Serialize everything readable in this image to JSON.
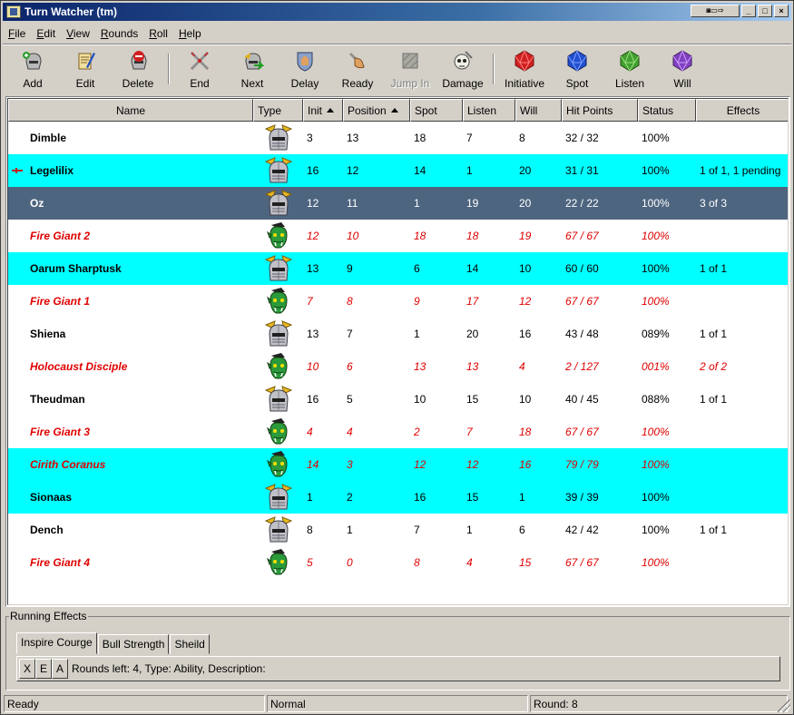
{
  "window": {
    "title": "Turn Watcher (tm)",
    "controls": [
      "minimize",
      "maximize",
      "close"
    ]
  },
  "menu": [
    {
      "label": "File",
      "key": "F",
      "rest": "ile"
    },
    {
      "label": "Edit",
      "key": "E",
      "rest": "dit"
    },
    {
      "label": "View",
      "key": "V",
      "rest": "iew"
    },
    {
      "label": "Rounds",
      "key": "R",
      "rest": "ounds"
    },
    {
      "label": "Roll",
      "key": "R",
      "rest": "oll"
    },
    {
      "label": "Help",
      "key": "H",
      "rest": "elp"
    }
  ],
  "toolbar": {
    "add": "Add",
    "edit": "Edit",
    "delete": "Delete",
    "end": "End",
    "next": "Next",
    "delay": "Delay",
    "ready": "Ready",
    "jump_in": "Jump In",
    "damage": "Damage",
    "initiative": "Initiative",
    "spot": "Spot",
    "listen": "Listen",
    "will": "Will"
  },
  "colors": {
    "ally_row": "#00ffff",
    "selected_row": "#4e6580",
    "enemy_text": "#e00000",
    "die_initiative": "#d02020",
    "die_spot": "#2050d0",
    "die_listen": "#40a030",
    "die_will": "#8040c0"
  },
  "grid": {
    "columns": [
      "Name",
      "Type",
      "Init",
      "Position",
      "Spot",
      "Listen",
      "Will",
      "Hit Points",
      "Status",
      "Effects"
    ],
    "sorted_columns": [
      "Init",
      "Position"
    ],
    "rows": [
      {
        "name": "Dimble",
        "type": "knight-helmet-icon",
        "init": "3",
        "position": "13",
        "spot": "18",
        "listen": "7",
        "will": "8",
        "hp": "32 / 32",
        "status": "100%",
        "effects": "",
        "style": "normal",
        "enemy": false,
        "current": false
      },
      {
        "name": "Legelilix",
        "type": "knight-helmet-icon",
        "init": "16",
        "position": "12",
        "spot": "14",
        "listen": "1",
        "will": "20",
        "hp": "31 / 31",
        "status": "100%",
        "effects": "1 of 1, 1 pending",
        "style": "cyan",
        "enemy": false,
        "current": true
      },
      {
        "name": "Oz",
        "type": "knight-helmet-icon",
        "init": "12",
        "position": "11",
        "spot": "1",
        "listen": "19",
        "will": "20",
        "hp": "22 / 22",
        "status": "100%",
        "effects": "3 of 3",
        "style": "sel",
        "enemy": false,
        "current": false
      },
      {
        "name": "Fire Giant 2",
        "type": "orc-head-icon",
        "init": "12",
        "position": "10",
        "spot": "18",
        "listen": "18",
        "will": "19",
        "hp": "67 / 67",
        "status": "100%",
        "effects": "",
        "style": "normal",
        "enemy": true,
        "current": false
      },
      {
        "name": "Oarum Sharptusk",
        "type": "knight-helmet-icon",
        "init": "13",
        "position": "9",
        "spot": "6",
        "listen": "14",
        "will": "10",
        "hp": "60 / 60",
        "status": "100%",
        "effects": "1 of 1",
        "style": "cyan",
        "enemy": false,
        "current": false
      },
      {
        "name": "Fire Giant 1",
        "type": "orc-head-icon",
        "init": "7",
        "position": "8",
        "spot": "9",
        "listen": "17",
        "will": "12",
        "hp": "67 / 67",
        "status": "100%",
        "effects": "",
        "style": "normal",
        "enemy": true,
        "current": false
      },
      {
        "name": "Shiena",
        "type": "knight-helmet-icon",
        "init": "13",
        "position": "7",
        "spot": "1",
        "listen": "20",
        "will": "16",
        "hp": "43 / 48",
        "status": "089%",
        "effects": "1 of 1",
        "style": "normal",
        "enemy": false,
        "current": false
      },
      {
        "name": "Holocaust Disciple",
        "type": "orc-head-icon",
        "init": "10",
        "position": "6",
        "spot": "13",
        "listen": "13",
        "will": "4",
        "hp": "2 / 127",
        "status": "001%",
        "effects": "2 of 2",
        "style": "normal",
        "enemy": true,
        "current": false
      },
      {
        "name": "Theudman",
        "type": "knight-helmet-icon",
        "init": "16",
        "position": "5",
        "spot": "10",
        "listen": "15",
        "will": "10",
        "hp": "40 / 45",
        "status": "088%",
        "effects": "1 of 1",
        "style": "normal",
        "enemy": false,
        "current": false
      },
      {
        "name": "Fire Giant 3",
        "type": "orc-head-icon",
        "init": "4",
        "position": "4",
        "spot": "2",
        "listen": "7",
        "will": "18",
        "hp": "67 / 67",
        "status": "100%",
        "effects": "",
        "style": "normal",
        "enemy": true,
        "current": false
      },
      {
        "name": "Cirith Coranus",
        "type": "orc-head-icon",
        "init": "14",
        "position": "3",
        "spot": "12",
        "listen": "12",
        "will": "16",
        "hp": "79 / 79",
        "status": "100%",
        "effects": "",
        "style": "cyan",
        "enemy": true,
        "current": false
      },
      {
        "name": "Sionaas",
        "type": "knight-helmet-icon",
        "init": "1",
        "position": "2",
        "spot": "16",
        "listen": "15",
        "will": "1",
        "hp": "39 / 39",
        "status": "100%",
        "effects": "",
        "style": "cyan",
        "enemy": false,
        "current": false
      },
      {
        "name": "Dench",
        "type": "knight-helmet-icon",
        "init": "8",
        "position": "1",
        "spot": "7",
        "listen": "1",
        "will": "6",
        "hp": "42 / 42",
        "status": "100%",
        "effects": "1 of 1",
        "style": "normal",
        "enemy": false,
        "current": false
      },
      {
        "name": "Fire Giant 4",
        "type": "orc-head-icon",
        "init": "5",
        "position": "0",
        "spot": "8",
        "listen": "4",
        "will": "15",
        "hp": "67 / 67",
        "status": "100%",
        "effects": "",
        "style": "normal",
        "enemy": true,
        "current": false
      }
    ]
  },
  "running_effects": {
    "title": "Running Effects",
    "tabs": [
      "Inspire Courge",
      "Bull Strength",
      "Sheild"
    ],
    "active_tab": 0,
    "buttons": [
      "X",
      "E",
      "A"
    ],
    "details": "Rounds left: 4, Type: Ability, Description:"
  },
  "statusbar": {
    "state": "Ready",
    "mode": "Normal",
    "round": "Round: 8"
  }
}
